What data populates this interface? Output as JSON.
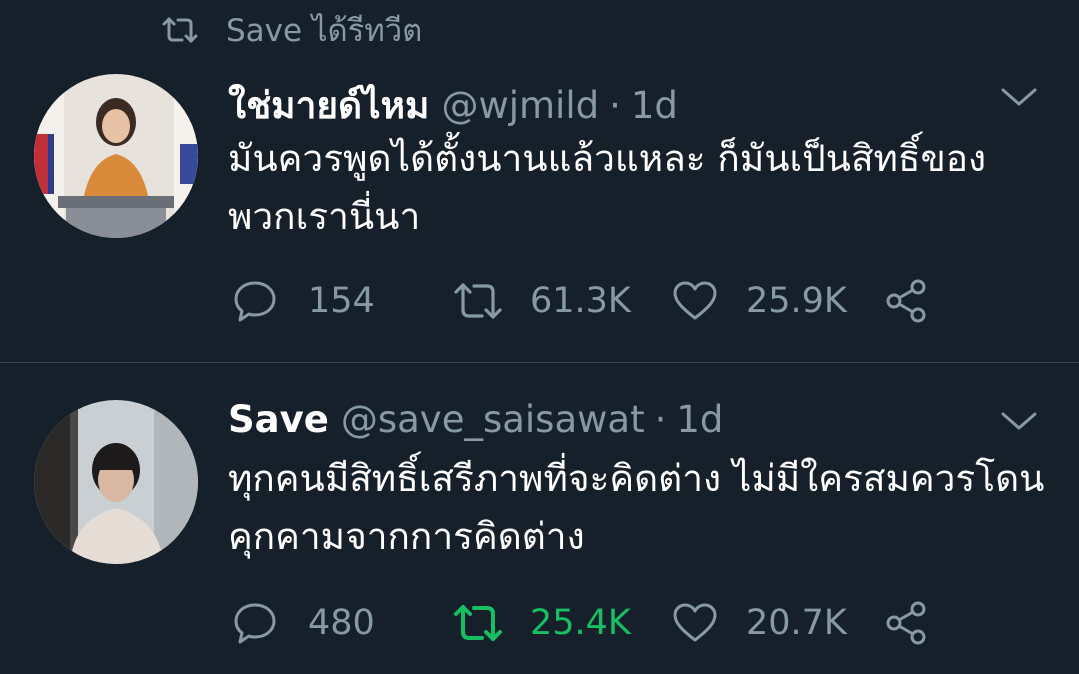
{
  "retweet_context": {
    "text": "Save ได้รีทวีต",
    "icon": "retweet-icon"
  },
  "tweets": [
    {
      "display_name": "ใช่มายด์ไหม",
      "handle": "@wjmild",
      "separator": "·",
      "time": "1d",
      "text": "มันควรพูดได้ตั้งนานแล้วแหละ ก็มันเป็นสิทธิ์ของพวกเรานี่นา",
      "replies": "154",
      "retweets": "61.3K",
      "likes": "25.9K",
      "retweeted": false
    },
    {
      "display_name": "Save",
      "handle": "@save_saisawat",
      "separator": "·",
      "time": "1d",
      "text": "ทุกคนมีสิทธิ์เสรีภาพที่จะคิดต่าง ไม่มีใครสมควรโดนคุกคามจากการคิดต่าง",
      "replies": "480",
      "retweets": "25.4K",
      "likes": "20.7K",
      "retweeted": true
    }
  ],
  "colors": {
    "background": "#15202b",
    "text": "#ffffff",
    "secondary": "#8899a6",
    "retweet_active": "#17bf63",
    "divider": "#38444d"
  }
}
